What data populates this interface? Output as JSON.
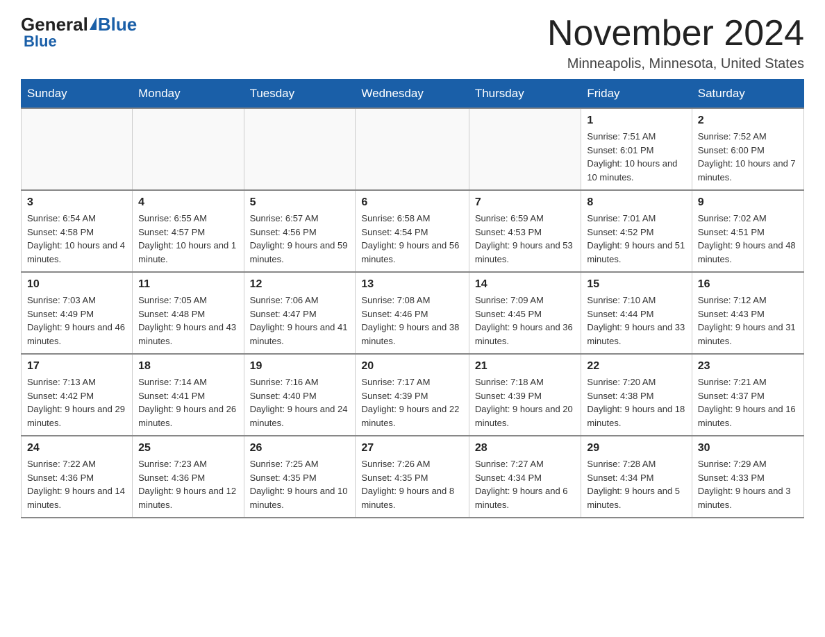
{
  "header": {
    "logo": {
      "general": "General",
      "blue": "Blue"
    },
    "title": "November 2024",
    "location": "Minneapolis, Minnesota, United States"
  },
  "calendar": {
    "days_of_week": [
      "Sunday",
      "Monday",
      "Tuesday",
      "Wednesday",
      "Thursday",
      "Friday",
      "Saturday"
    ],
    "weeks": [
      [
        {
          "day": "",
          "info": ""
        },
        {
          "day": "",
          "info": ""
        },
        {
          "day": "",
          "info": ""
        },
        {
          "day": "",
          "info": ""
        },
        {
          "day": "",
          "info": ""
        },
        {
          "day": "1",
          "info": "Sunrise: 7:51 AM\nSunset: 6:01 PM\nDaylight: 10 hours and 10 minutes."
        },
        {
          "day": "2",
          "info": "Sunrise: 7:52 AM\nSunset: 6:00 PM\nDaylight: 10 hours and 7 minutes."
        }
      ],
      [
        {
          "day": "3",
          "info": "Sunrise: 6:54 AM\nSunset: 4:58 PM\nDaylight: 10 hours and 4 minutes."
        },
        {
          "day": "4",
          "info": "Sunrise: 6:55 AM\nSunset: 4:57 PM\nDaylight: 10 hours and 1 minute."
        },
        {
          "day": "5",
          "info": "Sunrise: 6:57 AM\nSunset: 4:56 PM\nDaylight: 9 hours and 59 minutes."
        },
        {
          "day": "6",
          "info": "Sunrise: 6:58 AM\nSunset: 4:54 PM\nDaylight: 9 hours and 56 minutes."
        },
        {
          "day": "7",
          "info": "Sunrise: 6:59 AM\nSunset: 4:53 PM\nDaylight: 9 hours and 53 minutes."
        },
        {
          "day": "8",
          "info": "Sunrise: 7:01 AM\nSunset: 4:52 PM\nDaylight: 9 hours and 51 minutes."
        },
        {
          "day": "9",
          "info": "Sunrise: 7:02 AM\nSunset: 4:51 PM\nDaylight: 9 hours and 48 minutes."
        }
      ],
      [
        {
          "day": "10",
          "info": "Sunrise: 7:03 AM\nSunset: 4:49 PM\nDaylight: 9 hours and 46 minutes."
        },
        {
          "day": "11",
          "info": "Sunrise: 7:05 AM\nSunset: 4:48 PM\nDaylight: 9 hours and 43 minutes."
        },
        {
          "day": "12",
          "info": "Sunrise: 7:06 AM\nSunset: 4:47 PM\nDaylight: 9 hours and 41 minutes."
        },
        {
          "day": "13",
          "info": "Sunrise: 7:08 AM\nSunset: 4:46 PM\nDaylight: 9 hours and 38 minutes."
        },
        {
          "day": "14",
          "info": "Sunrise: 7:09 AM\nSunset: 4:45 PM\nDaylight: 9 hours and 36 minutes."
        },
        {
          "day": "15",
          "info": "Sunrise: 7:10 AM\nSunset: 4:44 PM\nDaylight: 9 hours and 33 minutes."
        },
        {
          "day": "16",
          "info": "Sunrise: 7:12 AM\nSunset: 4:43 PM\nDaylight: 9 hours and 31 minutes."
        }
      ],
      [
        {
          "day": "17",
          "info": "Sunrise: 7:13 AM\nSunset: 4:42 PM\nDaylight: 9 hours and 29 minutes."
        },
        {
          "day": "18",
          "info": "Sunrise: 7:14 AM\nSunset: 4:41 PM\nDaylight: 9 hours and 26 minutes."
        },
        {
          "day": "19",
          "info": "Sunrise: 7:16 AM\nSunset: 4:40 PM\nDaylight: 9 hours and 24 minutes."
        },
        {
          "day": "20",
          "info": "Sunrise: 7:17 AM\nSunset: 4:39 PM\nDaylight: 9 hours and 22 minutes."
        },
        {
          "day": "21",
          "info": "Sunrise: 7:18 AM\nSunset: 4:39 PM\nDaylight: 9 hours and 20 minutes."
        },
        {
          "day": "22",
          "info": "Sunrise: 7:20 AM\nSunset: 4:38 PM\nDaylight: 9 hours and 18 minutes."
        },
        {
          "day": "23",
          "info": "Sunrise: 7:21 AM\nSunset: 4:37 PM\nDaylight: 9 hours and 16 minutes."
        }
      ],
      [
        {
          "day": "24",
          "info": "Sunrise: 7:22 AM\nSunset: 4:36 PM\nDaylight: 9 hours and 14 minutes."
        },
        {
          "day": "25",
          "info": "Sunrise: 7:23 AM\nSunset: 4:36 PM\nDaylight: 9 hours and 12 minutes."
        },
        {
          "day": "26",
          "info": "Sunrise: 7:25 AM\nSunset: 4:35 PM\nDaylight: 9 hours and 10 minutes."
        },
        {
          "day": "27",
          "info": "Sunrise: 7:26 AM\nSunset: 4:35 PM\nDaylight: 9 hours and 8 minutes."
        },
        {
          "day": "28",
          "info": "Sunrise: 7:27 AM\nSunset: 4:34 PM\nDaylight: 9 hours and 6 minutes."
        },
        {
          "day": "29",
          "info": "Sunrise: 7:28 AM\nSunset: 4:34 PM\nDaylight: 9 hours and 5 minutes."
        },
        {
          "day": "30",
          "info": "Sunrise: 7:29 AM\nSunset: 4:33 PM\nDaylight: 9 hours and 3 minutes."
        }
      ]
    ]
  }
}
